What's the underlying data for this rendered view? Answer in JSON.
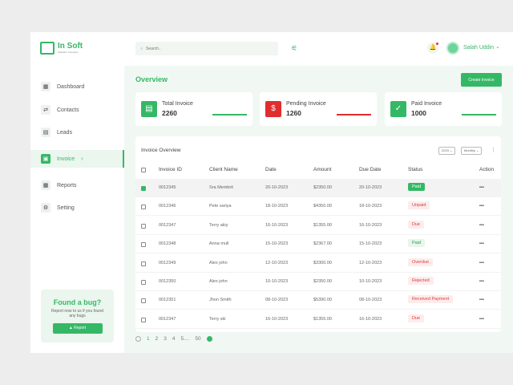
{
  "brand": {
    "name": "In Soft",
    "tagline": "Software Company"
  },
  "sidebar": {
    "items": [
      {
        "label": "Dashboard",
        "icon": "grid-icon"
      },
      {
        "label": "Contacts",
        "icon": "contacts-icon"
      },
      {
        "label": "Leads",
        "icon": "leads-icon"
      },
      {
        "label": "Invoice",
        "icon": "invoice-icon",
        "active": true
      },
      {
        "label": "Reports",
        "icon": "reports-icon"
      },
      {
        "label": "Setting",
        "icon": "gear-icon"
      }
    ],
    "bug": {
      "title": "Found a bug?",
      "text": "Report now to us if you found any bugs",
      "button": "Report"
    }
  },
  "header": {
    "search_placeholder": "Search..",
    "user": "Salah Uddin"
  },
  "main": {
    "title": "Overview",
    "create_label": "Create Invoice",
    "stats": [
      {
        "label": "Total Invoice",
        "value": "2260",
        "color": "#35b866"
      },
      {
        "label": "Pending Invoice",
        "value": "1260",
        "color": "#e02d2d"
      },
      {
        "label": "Paid Invoice",
        "value": "1000",
        "color": "#35b866"
      }
    ],
    "table": {
      "title": "Invoice Overview",
      "year": "2023",
      "period": "Monthly",
      "columns": [
        "Invoice ID",
        "Client Name",
        "Date",
        "Amount",
        "Due Date",
        "Status",
        "Action"
      ],
      "rows": [
        [
          "0012345",
          "Sra Membrit",
          "20-10-2023",
          "$2350.00",
          "20-10-2023",
          "Paid"
        ],
        [
          "0012346",
          "Pete sariya",
          "18-10-2023",
          "$4350.00",
          "18-10-2023",
          "Unpaid"
        ],
        [
          "0012347",
          "Terry akiy",
          "16-10-2023",
          "$1355.00",
          "16-10-2023",
          "Due"
        ],
        [
          "0012348",
          "Anna mull",
          "15-10-2023",
          "$2367.00",
          "15-10-2023",
          "Paid"
        ],
        [
          "0012349",
          "Alex john",
          "12-10-2023",
          "$3300.00",
          "12-10-2023",
          "Overdue"
        ],
        [
          "0012350",
          "Alex john",
          "10-10-2023",
          "$2350.00",
          "10-10-2023",
          "Rejected"
        ],
        [
          "0012351",
          "Jhon Smith",
          "08-10-2023",
          "$5390.00",
          "08-10-2023",
          "Received Payment"
        ],
        [
          "0012347",
          "Terry ski",
          "16-10-2023",
          "$1355.00",
          "16-10-2023",
          "Due"
        ]
      ],
      "action": "•••"
    },
    "pagination": [
      "1",
      "2",
      "3",
      "4",
      "5....",
      "50"
    ]
  }
}
